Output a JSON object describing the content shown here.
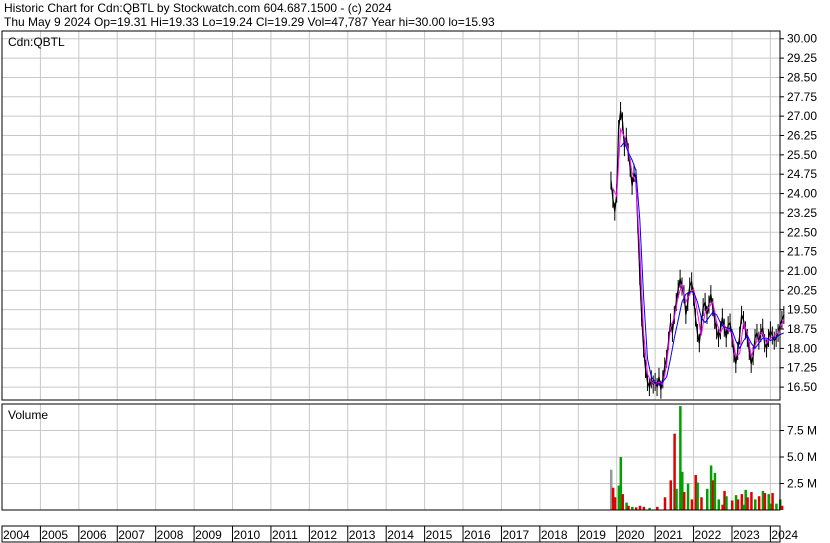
{
  "header": {
    "line1": "Historic Chart for Cdn:QBTL by Stockwatch.com 604.687.1500 - (c) 2024",
    "line2": "Thu May  9 2024   Op=19.31  Hi=19.33  Lo=19.24  Cl=19.29  Vol=47,787  Year hi=30.00  lo=15.93"
  },
  "chart_data": [
    {
      "type": "line",
      "symbol_label": "Cdn:QBTL",
      "ylim": [
        16.0,
        30.3
      ],
      "yticks": [
        "30.00",
        "29.25",
        "28.50",
        "27.75",
        "27.00",
        "26.25",
        "25.50",
        "24.75",
        "24.00",
        "23.25",
        "22.50",
        "21.75",
        "21.00",
        "20.25",
        "19.50",
        "18.75",
        "18.00",
        "17.25",
        "16.50"
      ],
      "x_years": [
        "2004",
        "2005",
        "2006",
        "2007",
        "2008",
        "2009",
        "2010",
        "2011",
        "2012",
        "2013",
        "2014",
        "2015",
        "2016",
        "2017",
        "2018",
        "2019",
        "2020",
        "2021",
        "2022",
        "2023",
        "2024"
      ],
      "grid": true,
      "colors": {
        "price": "#000000",
        "ma_short": "#ff00ff",
        "ma_long": "#0000ff"
      },
      "series": [
        {
          "key": "price",
          "x": [
            2019.85,
            2019.9,
            2019.95,
            2020.0,
            2020.05,
            2020.1,
            2020.15,
            2020.2,
            2020.25,
            2020.3,
            2020.35,
            2020.4,
            2020.45,
            2020.5,
            2020.55,
            2020.6,
            2020.65,
            2020.7,
            2020.75,
            2020.8,
            2020.85,
            2020.9,
            2020.95,
            2021.0,
            2021.05,
            2021.1,
            2021.15,
            2021.2,
            2021.25,
            2021.3,
            2021.35,
            2021.4,
            2021.45,
            2021.5,
            2021.55,
            2021.6,
            2021.65,
            2021.7,
            2021.75,
            2021.8,
            2021.85,
            2021.9,
            2021.95,
            2022.0,
            2022.05,
            2022.1,
            2022.15,
            2022.2,
            2022.25,
            2022.3,
            2022.35,
            2022.4,
            2022.45,
            2022.5,
            2022.55,
            2022.6,
            2022.65,
            2022.7,
            2022.75,
            2022.8,
            2022.85,
            2022.9,
            2022.95,
            2023.0,
            2023.05,
            2023.1,
            2023.15,
            2023.2,
            2023.25,
            2023.3,
            2023.35,
            2023.4,
            2023.45,
            2023.5,
            2023.55,
            2023.6,
            2023.65,
            2023.7,
            2023.75,
            2023.8,
            2023.85,
            2023.9,
            2023.95,
            2024.0,
            2024.05,
            2024.1,
            2024.15,
            2024.2,
            2024.25,
            2024.3,
            2024.35
          ],
          "values": [
            24.5,
            23.8,
            23.3,
            24.0,
            26.5,
            27.2,
            26.8,
            25.8,
            26.2,
            25.6,
            25.0,
            24.3,
            24.8,
            24.6,
            22.8,
            20.8,
            19.2,
            18.0,
            17.2,
            16.7,
            16.5,
            16.8,
            16.6,
            16.7,
            16.5,
            16.9,
            16.4,
            16.8,
            17.3,
            17.6,
            18.3,
            19.0,
            18.6,
            19.3,
            19.8,
            20.3,
            20.7,
            20.4,
            20.1,
            19.3,
            19.8,
            20.4,
            20.6,
            20.0,
            19.2,
            18.6,
            18.2,
            18.9,
            19.6,
            19.8,
            19.3,
            19.7,
            20.1,
            19.6,
            19.1,
            18.7,
            18.4,
            18.7,
            19.2,
            18.8,
            18.4,
            18.9,
            19.0,
            18.4,
            17.8,
            17.4,
            17.9,
            18.5,
            19.3,
            19.1,
            18.7,
            18.4,
            17.9,
            17.4,
            17.7,
            18.4,
            18.6,
            18.3,
            18.6,
            18.8,
            18.2,
            18.0,
            18.4,
            18.7,
            18.5,
            18.3,
            18.4,
            18.6,
            18.9,
            19.1,
            19.29
          ]
        },
        {
          "key": "ma_short",
          "x": [
            2019.9,
            2020.0,
            2020.1,
            2020.2,
            2020.3,
            2020.4,
            2020.5,
            2020.6,
            2020.7,
            2020.8,
            2020.9,
            2021.0,
            2021.1,
            2021.2,
            2021.3,
            2021.4,
            2021.5,
            2021.6,
            2021.7,
            2021.8,
            2021.9,
            2022.0,
            2022.1,
            2022.2,
            2022.3,
            2022.4,
            2022.5,
            2022.6,
            2022.7,
            2022.8,
            2022.9,
            2023.0,
            2023.1,
            2023.2,
            2023.3,
            2023.4,
            2023.5,
            2023.6,
            2023.7,
            2023.8,
            2023.9,
            2024.0,
            2024.1,
            2024.2,
            2024.35
          ],
          "values": [
            24.2,
            23.9,
            26.5,
            26.2,
            25.7,
            24.8,
            24.4,
            21.8,
            18.6,
            17.0,
            16.7,
            16.6,
            16.7,
            16.6,
            17.4,
            18.8,
            19.2,
            20.0,
            20.5,
            19.8,
            20.1,
            20.3,
            19.4,
            18.5,
            19.4,
            19.6,
            19.8,
            19.0,
            18.6,
            18.9,
            18.7,
            18.6,
            17.7,
            17.8,
            19.0,
            18.6,
            17.7,
            18.1,
            18.5,
            18.6,
            18.2,
            18.4,
            18.5,
            18.6,
            19.1
          ]
        },
        {
          "key": "ma_long",
          "x": [
            2020.1,
            2020.2,
            2020.3,
            2020.4,
            2020.5,
            2020.6,
            2020.7,
            2020.8,
            2020.9,
            2021.0,
            2021.1,
            2021.2,
            2021.3,
            2021.4,
            2021.5,
            2021.6,
            2021.7,
            2021.8,
            2021.9,
            2022.0,
            2022.1,
            2022.2,
            2022.3,
            2022.4,
            2022.5,
            2022.6,
            2022.7,
            2022.8,
            2022.9,
            2023.0,
            2023.1,
            2023.2,
            2023.3,
            2023.4,
            2023.5,
            2023.6,
            2023.7,
            2023.8,
            2023.9,
            2024.0,
            2024.1,
            2024.2,
            2024.35
          ],
          "values": [
            25.8,
            26.0,
            25.6,
            25.3,
            24.9,
            23.0,
            20.0,
            17.6,
            16.9,
            16.7,
            16.6,
            16.7,
            16.9,
            17.6,
            18.4,
            19.1,
            19.8,
            20.1,
            20.2,
            20.2,
            19.8,
            19.2,
            19.0,
            19.2,
            19.4,
            19.3,
            19.0,
            18.8,
            18.8,
            18.7,
            18.3,
            18.0,
            18.3,
            18.5,
            18.2,
            18.0,
            18.2,
            18.4,
            18.4,
            18.3,
            18.4,
            18.5,
            18.6
          ]
        }
      ]
    },
    {
      "type": "bar",
      "label": "Volume",
      "ylim": [
        0,
        10000000
      ],
      "yticks": [
        "7.5 M",
        "5.0 M",
        "2.5 M"
      ],
      "colors": {
        "up": "#00a000",
        "down": "#e00000",
        "neutral": "#999999"
      },
      "bars": [
        {
          "x": 2019.85,
          "v": 3800000,
          "c": "neutral"
        },
        {
          "x": 2019.9,
          "v": 2100000,
          "c": "down"
        },
        {
          "x": 2019.95,
          "v": 1200000,
          "c": "down"
        },
        {
          "x": 2020.05,
          "v": 2300000,
          "c": "up"
        },
        {
          "x": 2020.1,
          "v": 5000000,
          "c": "up"
        },
        {
          "x": 2020.15,
          "v": 1500000,
          "c": "down"
        },
        {
          "x": 2020.25,
          "v": 700000,
          "c": "up"
        },
        {
          "x": 2020.3,
          "v": 400000,
          "c": "down"
        },
        {
          "x": 2020.4,
          "v": 300000,
          "c": "up"
        },
        {
          "x": 2020.5,
          "v": 250000,
          "c": "down"
        },
        {
          "x": 2020.6,
          "v": 400000,
          "c": "down"
        },
        {
          "x": 2020.7,
          "v": 300000,
          "c": "down"
        },
        {
          "x": 2020.85,
          "v": 200000,
          "c": "up"
        },
        {
          "x": 2021.05,
          "v": 300000,
          "c": "down"
        },
        {
          "x": 2021.25,
          "v": 1200000,
          "c": "down"
        },
        {
          "x": 2021.4,
          "v": 2800000,
          "c": "down"
        },
        {
          "x": 2021.5,
          "v": 7200000,
          "c": "down"
        },
        {
          "x": 2021.55,
          "v": 2000000,
          "c": "up"
        },
        {
          "x": 2021.65,
          "v": 9800000,
          "c": "up"
        },
        {
          "x": 2021.7,
          "v": 3600000,
          "c": "up"
        },
        {
          "x": 2021.75,
          "v": 1700000,
          "c": "down"
        },
        {
          "x": 2021.85,
          "v": 2500000,
          "c": "up"
        },
        {
          "x": 2021.95,
          "v": 1000000,
          "c": "down"
        },
        {
          "x": 2022.05,
          "v": 3300000,
          "c": "down"
        },
        {
          "x": 2022.1,
          "v": 2600000,
          "c": "up"
        },
        {
          "x": 2022.2,
          "v": 1200000,
          "c": "down"
        },
        {
          "x": 2022.35,
          "v": 2000000,
          "c": "up"
        },
        {
          "x": 2022.45,
          "v": 4200000,
          "c": "up"
        },
        {
          "x": 2022.5,
          "v": 2800000,
          "c": "down"
        },
        {
          "x": 2022.55,
          "v": 3500000,
          "c": "up"
        },
        {
          "x": 2022.65,
          "v": 1000000,
          "c": "up"
        },
        {
          "x": 2022.75,
          "v": 500000,
          "c": "down"
        },
        {
          "x": 2022.8,
          "v": 1800000,
          "c": "down"
        },
        {
          "x": 2022.85,
          "v": 1300000,
          "c": "up"
        },
        {
          "x": 2023.0,
          "v": 900000,
          "c": "down"
        },
        {
          "x": 2023.1,
          "v": 1400000,
          "c": "up"
        },
        {
          "x": 2023.15,
          "v": 1000000,
          "c": "down"
        },
        {
          "x": 2023.25,
          "v": 1500000,
          "c": "down"
        },
        {
          "x": 2023.3,
          "v": 500000,
          "c": "up"
        },
        {
          "x": 2023.35,
          "v": 1900000,
          "c": "up"
        },
        {
          "x": 2023.4,
          "v": 1200000,
          "c": "down"
        },
        {
          "x": 2023.5,
          "v": 1700000,
          "c": "down"
        },
        {
          "x": 2023.6,
          "v": 1000000,
          "c": "up"
        },
        {
          "x": 2023.7,
          "v": 1300000,
          "c": "down"
        },
        {
          "x": 2023.8,
          "v": 1800000,
          "c": "up"
        },
        {
          "x": 2023.85,
          "v": 1600000,
          "c": "down"
        },
        {
          "x": 2023.95,
          "v": 1500000,
          "c": "up"
        },
        {
          "x": 2024.0,
          "v": 600000,
          "c": "up"
        },
        {
          "x": 2024.05,
          "v": 1600000,
          "c": "down"
        },
        {
          "x": 2024.15,
          "v": 600000,
          "c": "up"
        },
        {
          "x": 2024.25,
          "v": 1000000,
          "c": "up"
        },
        {
          "x": 2024.3,
          "v": 400000,
          "c": "down"
        }
      ]
    }
  ]
}
